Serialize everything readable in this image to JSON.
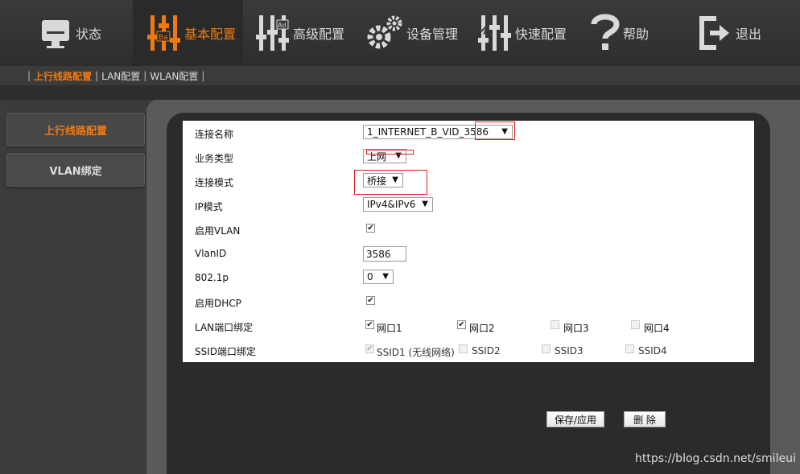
{
  "nav": [
    {
      "label": "状态",
      "icon": "monitor-icon"
    },
    {
      "label": "基本配置",
      "icon": "sliders-basic-icon",
      "active": true
    },
    {
      "label": "高级配置",
      "icon": "sliders-advanced-icon"
    },
    {
      "label": "设备管理",
      "icon": "gears-icon"
    },
    {
      "label": "快速配置",
      "icon": "sliders-quick-icon"
    },
    {
      "label": "帮助",
      "icon": "question-icon"
    },
    {
      "label": "退出",
      "icon": "exit-icon"
    }
  ],
  "subnav": [
    {
      "label": "上行线路配置",
      "active": true
    },
    {
      "label": "LAN配置"
    },
    {
      "label": "WLAN配置"
    }
  ],
  "sidebar": [
    {
      "label": "上行线路配置",
      "active": true
    },
    {
      "label": "VLAN绑定"
    }
  ],
  "form": {
    "connection_name": {
      "label": "连接名称",
      "value": "1_INTERNET_B_VID_3586"
    },
    "service_type": {
      "label": "业务类型",
      "value": "上网"
    },
    "connection_mode": {
      "label": "连接模式",
      "value": "桥接"
    },
    "ip_mode": {
      "label": "IP模式",
      "value": "IPv4&IPv6"
    },
    "enable_vlan": {
      "label": "启用VLAN",
      "checked": true
    },
    "vlan_id": {
      "label": "VlanID",
      "value": "3586"
    },
    "priority": {
      "label": "802.1p",
      "value": "0"
    },
    "enable_dhcp": {
      "label": "启用DHCP",
      "checked": true
    },
    "lan_binding": {
      "label": "LAN端口绑定",
      "ports": [
        {
          "label": "网口1",
          "checked": true
        },
        {
          "label": "网口2",
          "checked": true
        },
        {
          "label": "网口3",
          "checked": false
        },
        {
          "label": "网口4",
          "checked": false
        }
      ]
    },
    "ssid_binding": {
      "label": "SSID端口绑定",
      "ports": [
        {
          "label": "SSID1 (无线网络)",
          "checked": true
        },
        {
          "label": "SSID2",
          "checked": false
        },
        {
          "label": "SSID3",
          "checked": false
        },
        {
          "label": "SSID4",
          "checked": false
        }
      ]
    }
  },
  "buttons": {
    "save": "保存/应用",
    "delete": "删 除"
  },
  "watermark": "https://blog.csdn.net/smileui",
  "colors": {
    "accent": "#f07a12",
    "annotation": "#e02020",
    "background": "#3b3b3b"
  }
}
